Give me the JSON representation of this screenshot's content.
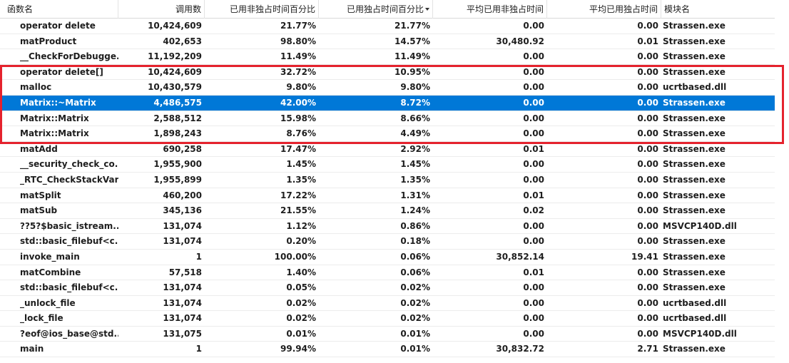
{
  "table": {
    "headers": {
      "function_name": "函数名",
      "calls": "调用数",
      "inclusive_pct": "已用非独占时间百分比",
      "exclusive_pct": "已用独占时间百分比",
      "avg_inclusive": "平均已用非独占时间",
      "avg_exclusive": "平均已用独占时间",
      "module": "模块名"
    },
    "sorted_column": "exclusive_pct",
    "sort_direction": "descending",
    "selected_row_index": 5,
    "highlight_color": "#e5222d",
    "selection_color": "#0078d7",
    "rows": [
      {
        "name": "operator delete",
        "calls": "10,424,609",
        "incl": "21.77%",
        "excl": "21.77%",
        "avg_incl": "0.00",
        "avg_excl": "0.00",
        "module": "Strassen.exe"
      },
      {
        "name": "matProduct",
        "calls": "402,653",
        "incl": "98.80%",
        "excl": "14.57%",
        "avg_incl": "30,480.92",
        "avg_excl": "0.01",
        "module": "Strassen.exe"
      },
      {
        "name": "__CheckForDebugge...",
        "calls": "11,192,209",
        "incl": "11.49%",
        "excl": "11.49%",
        "avg_incl": "0.00",
        "avg_excl": "0.00",
        "module": "Strassen.exe"
      },
      {
        "name": "operator delete[]",
        "calls": "10,424,609",
        "incl": "32.72%",
        "excl": "10.95%",
        "avg_incl": "0.00",
        "avg_excl": "0.00",
        "module": "Strassen.exe"
      },
      {
        "name": "malloc",
        "calls": "10,430,579",
        "incl": "9.80%",
        "excl": "9.80%",
        "avg_incl": "0.00",
        "avg_excl": "0.00",
        "module": "ucrtbased.dll"
      },
      {
        "name": "Matrix::~Matrix",
        "calls": "4,486,575",
        "incl": "42.00%",
        "excl": "8.72%",
        "avg_incl": "0.00",
        "avg_excl": "0.00",
        "module": "Strassen.exe"
      },
      {
        "name": "Matrix::Matrix",
        "calls": "2,588,512",
        "incl": "15.98%",
        "excl": "8.66%",
        "avg_incl": "0.00",
        "avg_excl": "0.00",
        "module": "Strassen.exe"
      },
      {
        "name": "Matrix::Matrix",
        "calls": "1,898,243",
        "incl": "8.76%",
        "excl": "4.49%",
        "avg_incl": "0.00",
        "avg_excl": "0.00",
        "module": "Strassen.exe"
      },
      {
        "name": "matAdd",
        "calls": "690,258",
        "incl": "17.47%",
        "excl": "2.92%",
        "avg_incl": "0.01",
        "avg_excl": "0.00",
        "module": "Strassen.exe"
      },
      {
        "name": "__security_check_co...",
        "calls": "1,955,900",
        "incl": "1.45%",
        "excl": "1.45%",
        "avg_incl": "0.00",
        "avg_excl": "0.00",
        "module": "Strassen.exe"
      },
      {
        "name": "_RTC_CheckStackVars",
        "calls": "1,955,899",
        "incl": "1.35%",
        "excl": "1.35%",
        "avg_incl": "0.00",
        "avg_excl": "0.00",
        "module": "Strassen.exe"
      },
      {
        "name": "matSplit",
        "calls": "460,200",
        "incl": "17.22%",
        "excl": "1.31%",
        "avg_incl": "0.01",
        "avg_excl": "0.00",
        "module": "Strassen.exe"
      },
      {
        "name": "matSub",
        "calls": "345,136",
        "incl": "21.55%",
        "excl": "1.24%",
        "avg_incl": "0.02",
        "avg_excl": "0.00",
        "module": "Strassen.exe"
      },
      {
        "name": "??5?$basic_istream...",
        "calls": "131,074",
        "incl": "1.12%",
        "excl": "0.86%",
        "avg_incl": "0.00",
        "avg_excl": "0.00",
        "module": "MSVCP140D.dll"
      },
      {
        "name": "std::basic_filebuf<c...",
        "calls": "131,074",
        "incl": "0.20%",
        "excl": "0.18%",
        "avg_incl": "0.00",
        "avg_excl": "0.00",
        "module": "Strassen.exe"
      },
      {
        "name": "invoke_main",
        "calls": "1",
        "incl": "100.00%",
        "excl": "0.06%",
        "avg_incl": "30,852.14",
        "avg_excl": "19.41",
        "module": "Strassen.exe"
      },
      {
        "name": "matCombine",
        "calls": "57,518",
        "incl": "1.40%",
        "excl": "0.06%",
        "avg_incl": "0.01",
        "avg_excl": "0.00",
        "module": "Strassen.exe"
      },
      {
        "name": "std::basic_filebuf<c...",
        "calls": "131,074",
        "incl": "0.05%",
        "excl": "0.02%",
        "avg_incl": "0.00",
        "avg_excl": "0.00",
        "module": "Strassen.exe"
      },
      {
        "name": "_unlock_file",
        "calls": "131,074",
        "incl": "0.02%",
        "excl": "0.02%",
        "avg_incl": "0.00",
        "avg_excl": "0.00",
        "module": "ucrtbased.dll"
      },
      {
        "name": "_lock_file",
        "calls": "131,074",
        "incl": "0.02%",
        "excl": "0.02%",
        "avg_incl": "0.00",
        "avg_excl": "0.00",
        "module": "ucrtbased.dll"
      },
      {
        "name": "?eof@ios_base@std...",
        "calls": "131,075",
        "incl": "0.01%",
        "excl": "0.01%",
        "avg_incl": "0.00",
        "avg_excl": "0.00",
        "module": "MSVCP140D.dll"
      },
      {
        "name": "main",
        "calls": "1",
        "incl": "99.94%",
        "excl": "0.01%",
        "avg_incl": "30,832.72",
        "avg_excl": "2.71",
        "module": "Strassen.exe"
      }
    ]
  }
}
